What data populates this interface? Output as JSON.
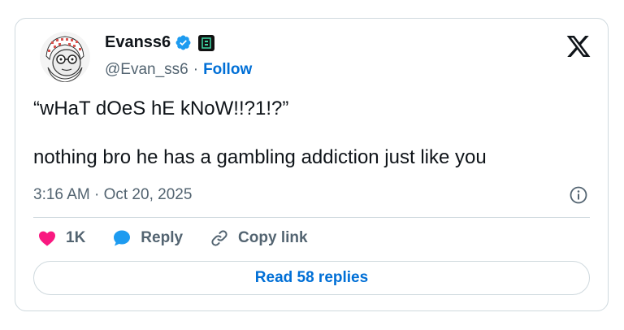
{
  "author": {
    "name": "Evanss6",
    "handle": "@Evan_ss6",
    "separator": "·",
    "follow_label": "Follow"
  },
  "tweet": {
    "line1": "“wHaT dOeS hE kNoW!!?1!?”",
    "line2": "nothing bro he has a gambling addiction just like you",
    "timestamp": "3:16 AM · Oct 20, 2025"
  },
  "actions": {
    "likes": "1K",
    "reply_label": "Reply",
    "copy_link_label": "Copy link"
  },
  "replies_button": "Read 58 replies",
  "icons": [
    "verified-badge-icon",
    "affiliate-badge-icon",
    "x-logo-icon",
    "info-icon",
    "heart-icon",
    "reply-bubble-icon",
    "link-icon"
  ],
  "colors": {
    "like": "#f91880",
    "reply": "#1d9bf0",
    "link_blue": "#006fd6",
    "verified": "#1d9bf0"
  }
}
